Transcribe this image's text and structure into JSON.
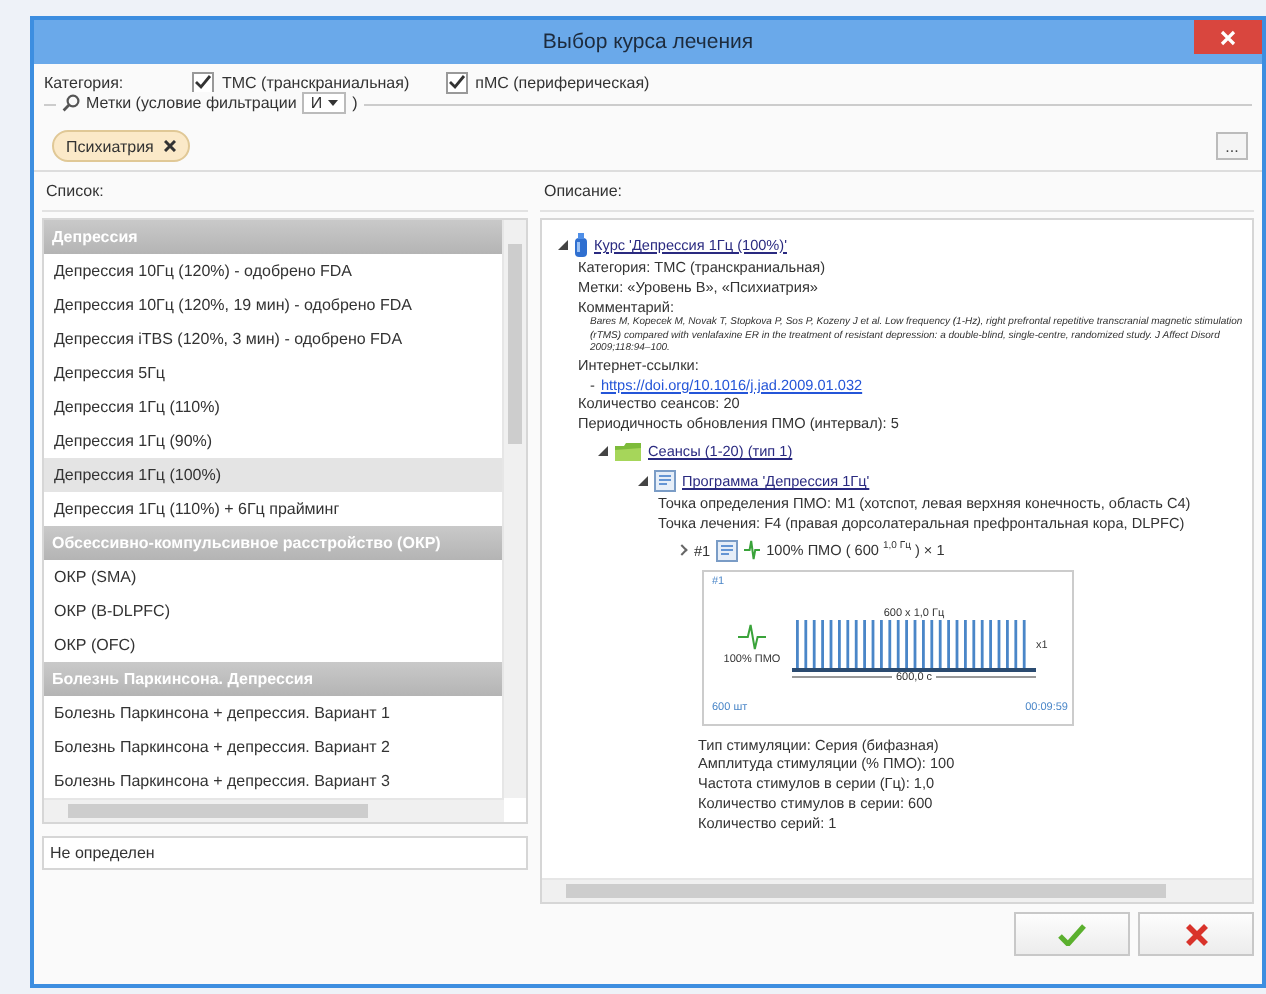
{
  "window": {
    "title": "Выбор курса лечения"
  },
  "categories_label": "Категория:",
  "categories": [
    {
      "label": "ТМС (транскраниальная)",
      "checked": true
    },
    {
      "label": "пМС (периферическая)",
      "checked": true
    }
  ],
  "tags_filter": {
    "label": "Метки (условие фильтрации",
    "operator": "И",
    "closing": ")"
  },
  "tags": [
    {
      "label": "Психиатрия"
    }
  ],
  "browse_button": "...",
  "list": {
    "label": "Список:",
    "groups": [
      {
        "title": "Депрессия",
        "items": [
          {
            "label": "Депрессия 10Гц (120%) - одобрено FDA",
            "selected": false
          },
          {
            "label": "Депрессия 10Гц (120%, 19 мин) - одобрено FDA",
            "selected": false
          },
          {
            "label": "Депрессия iTBS (120%, 3 мин) - одобрено FDA",
            "selected": false
          },
          {
            "label": "Депрессия 5Гц",
            "selected": false
          },
          {
            "label": "Депрессия 1Гц (110%)",
            "selected": false
          },
          {
            "label": "Депрессия 1Гц (90%)",
            "selected": false
          },
          {
            "label": "Депрессия 1Гц (100%)",
            "selected": true
          },
          {
            "label": "Депрессия 1Гц (110%) + 6Гц прайминг",
            "selected": false
          }
        ]
      },
      {
        "title": "Обсессивно-компульсивное расстройство (ОКР)",
        "items": [
          {
            "label": "ОКР (SMA)",
            "selected": false
          },
          {
            "label": "ОКР (B-DLPFC)",
            "selected": false
          },
          {
            "label": "ОКР (OFC)",
            "selected": false
          }
        ]
      },
      {
        "title": "Болезнь Паркинсона. Депрессия",
        "items": [
          {
            "label": "Болезнь Паркинсона + депрессия. Вариант 1",
            "selected": false
          },
          {
            "label": "Болезнь Паркинсона + депрессия. Вариант 2",
            "selected": false
          },
          {
            "label": "Болезнь Паркинсона + депрессия. Вариант 3",
            "selected": false
          }
        ]
      }
    ]
  },
  "status_field": "Не определен",
  "description": {
    "label": "Описание:",
    "tree": [
      {
        "kind": "course",
        "title": "Курс 'Депрессия 1Гц (100%)'",
        "expanded": true,
        "details": [
          {
            "kind": "text",
            "text": "Категория: ТМС (транскраниальная)"
          },
          {
            "kind": "text",
            "text": "Метки: «Уровень B», «Психиатрия»"
          },
          {
            "kind": "text",
            "text": "Комментарий:"
          },
          {
            "kind": "citation",
            "text": "Bares M, Kopecek M, Novak T, Stopkova P, Sos P, Kozeny J et al. Low frequency (1-Hz), right prefrontal repetitive transcranial magnetic stimulation (rTMS) compared with venlafaxine ER in the treatment of resistant depression: a double-blind, single-centre, randomized study. J Affect Disord 2009;118:94–100."
          },
          {
            "kind": "text",
            "text": "Интернет-ссылки:"
          },
          {
            "kind": "link",
            "bullet": "-",
            "text": "https://doi.org/10.1016/j.jad.2009.01.032"
          },
          {
            "kind": "text",
            "text": "Количество сеансов: 20"
          },
          {
            "kind": "text",
            "text": "Периодичность обновления ПМО (интервал): 5"
          }
        ],
        "children": [
          {
            "kind": "sessions",
            "title": "Сеансы (1-20) (тип 1)",
            "expanded": true,
            "children": [
              {
                "kind": "program",
                "title": "Программа 'Депрессия 1Гц'",
                "expanded": true,
                "details": [
                  {
                    "kind": "text",
                    "text": "Точка определения ПМО: M1 (хотспот, левая верхняя конечность, область C4)"
                  },
                  {
                    "kind": "text",
                    "text": "Точка лечения: F4 (правая дорсолатеральная префронтальная кора, DLPFC)"
                  }
                ],
                "children": [
                  {
                    "kind": "step",
                    "number": "#1",
                    "title": "100% ПМО ( 600 $^{1,0 Гц}$ ) × 1",
                    "expanded": false,
                    "card": {
                      "number": "#1",
                      "amplitude": "100% ПМО",
                      "series": "600 x 1,0 Гц",
                      "repeat": "x1",
                      "duration": "600,0 с",
                      "count": "600 шт",
                      "time": "00:09:59"
                    },
                    "details": [
                      {
                        "kind": "text",
                        "text": "Тип стимуляции: Серия (бифазная)"
                      },
                      {
                        "kind": "text",
                        "text": "Амплитуда стимуляции (% ПМО): 100"
                      },
                      {
                        "kind": "text",
                        "text": "Частота стимулов в серии (Гц): 1,0"
                      },
                      {
                        "kind": "text",
                        "text": "Количество стимулов в серии: 600"
                      },
                      {
                        "kind": "text",
                        "text": "Количество серий: 1"
                      }
                    ]
                  }
                ]
              }
            ]
          }
        ]
      }
    ]
  }
}
